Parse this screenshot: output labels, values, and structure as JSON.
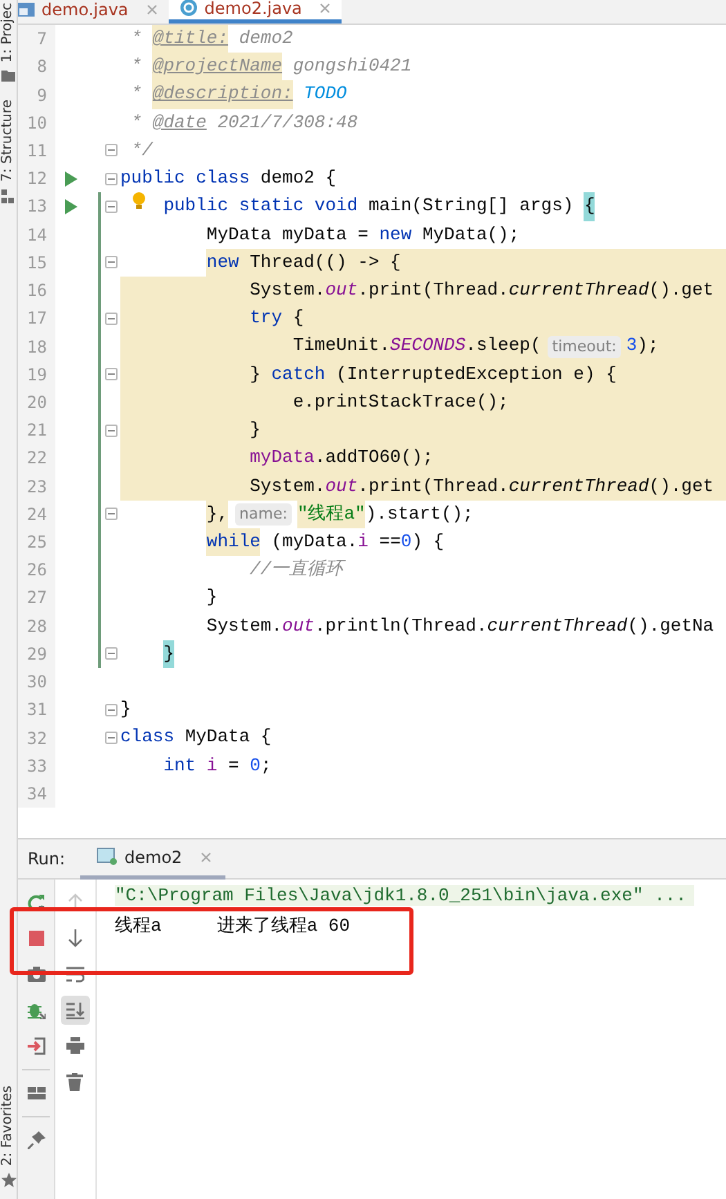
{
  "side_strip": {
    "top": [
      {
        "label": "1: Projec",
        "kind": "project"
      },
      {
        "label": "7: Structure",
        "kind": "structure"
      }
    ],
    "bottom": [
      {
        "label": "2: Favorites",
        "kind": "favorites"
      }
    ]
  },
  "editor": {
    "tabs": [
      {
        "label": "demo.java",
        "selected": false
      },
      {
        "label": "demo2.java",
        "selected": true
      }
    ],
    "lines": [
      {
        "number": "7",
        "run": false,
        "fold": false,
        "changed": false,
        "highlighted": false,
        "tokens": [
          {
            "kind": "comment",
            "text": " * "
          },
          {
            "kind": "doctag",
            "text": "@title:",
            "marked": true
          },
          {
            "kind": "comment",
            "text": " demo2"
          }
        ]
      },
      {
        "number": "8",
        "run": false,
        "fold": false,
        "changed": false,
        "highlighted": false,
        "tokens": [
          {
            "kind": "comment",
            "text": " * "
          },
          {
            "kind": "doctag",
            "text": "@projectName",
            "marked": true
          },
          {
            "kind": "comment",
            "text": " gongshi0421"
          }
        ]
      },
      {
        "number": "9",
        "run": false,
        "fold": false,
        "changed": false,
        "highlighted": false,
        "tokens": [
          {
            "kind": "comment",
            "text": " * "
          },
          {
            "kind": "doctag",
            "text": "@description:",
            "marked": true
          },
          {
            "kind": "todo",
            "text": " TODO"
          }
        ]
      },
      {
        "number": "10",
        "run": false,
        "fold": false,
        "changed": false,
        "highlighted": false,
        "tokens": [
          {
            "kind": "comment",
            "text": " * "
          },
          {
            "kind": "doctag",
            "text": "@date"
          },
          {
            "kind": "comment",
            "text": " 2021/7/308:48"
          }
        ]
      },
      {
        "number": "11",
        "run": false,
        "fold": true,
        "changed": false,
        "highlighted": false,
        "tokens": [
          {
            "kind": "comment",
            "text": " */"
          }
        ]
      },
      {
        "number": "12",
        "run": true,
        "fold": true,
        "changed": false,
        "highlighted": false,
        "tokens": [
          {
            "kind": "keyword",
            "text": "public class"
          },
          {
            "kind": "plain",
            "text": " demo2 {"
          }
        ]
      },
      {
        "number": "13",
        "run": true,
        "fold": true,
        "changed": true,
        "highlighted": false,
        "tokens": [
          {
            "kind": "bulb"
          },
          {
            "kind": "keyword",
            "text": "    public static void"
          },
          {
            "kind": "plain",
            "text": " main(String[] args) "
          },
          {
            "kind": "brace",
            "text": "{"
          }
        ]
      },
      {
        "number": "14",
        "run": false,
        "fold": false,
        "changed": true,
        "highlighted": false,
        "tokens": [
          {
            "kind": "plain",
            "text": "        MyData myData = "
          },
          {
            "kind": "keyword",
            "text": "new"
          },
          {
            "kind": "plain",
            "text": " MyData();"
          }
        ]
      },
      {
        "number": "15",
        "run": false,
        "fold": true,
        "changed": true,
        "highlighted": true,
        "tokens": [
          {
            "kind": "keyword",
            "text": "        new"
          },
          {
            "kind": "plain",
            "text": " Thread(() -> {"
          }
        ]
      },
      {
        "number": "16",
        "run": false,
        "fold": false,
        "changed": true,
        "highlighted": true,
        "tokens": [
          {
            "kind": "plain",
            "text": "            System."
          },
          {
            "kind": "field",
            "text": "out"
          },
          {
            "kind": "plain",
            "text": ".print(Thread."
          },
          {
            "kind": "static_call",
            "text": "currentThread"
          },
          {
            "kind": "plain",
            "text": "().get"
          }
        ]
      },
      {
        "number": "17",
        "run": false,
        "fold": true,
        "changed": true,
        "highlighted": true,
        "tokens": [
          {
            "kind": "keyword",
            "text": "            try"
          },
          {
            "kind": "plain",
            "text": " {"
          }
        ]
      },
      {
        "number": "18",
        "run": false,
        "fold": false,
        "changed": true,
        "highlighted": true,
        "tokens": [
          {
            "kind": "plain",
            "text": "                TimeUnit."
          },
          {
            "kind": "field",
            "text": "SECONDS"
          },
          {
            "kind": "plain",
            "text": ".sleep("
          },
          {
            "kind": "hint",
            "text": "timeout:"
          },
          {
            "kind": "number",
            "text": "3"
          },
          {
            "kind": "plain",
            "text": ");"
          }
        ]
      },
      {
        "number": "19",
        "run": false,
        "fold": true,
        "changed": true,
        "highlighted": true,
        "tokens": [
          {
            "kind": "plain",
            "text": "            } "
          },
          {
            "kind": "keyword",
            "text": "catch"
          },
          {
            "kind": "plain",
            "text": " (InterruptedException e) {"
          }
        ]
      },
      {
        "number": "20",
        "run": false,
        "fold": false,
        "changed": true,
        "highlighted": true,
        "tokens": [
          {
            "kind": "plain",
            "text": "                e.printStackTrace();"
          }
        ]
      },
      {
        "number": "21",
        "run": false,
        "fold": true,
        "changed": true,
        "highlighted": true,
        "tokens": [
          {
            "kind": "plain",
            "text": "            }"
          }
        ]
      },
      {
        "number": "22",
        "run": false,
        "fold": false,
        "changed": true,
        "highlighted": true,
        "tokens": [
          {
            "kind": "variable",
            "text": "            myData"
          },
          {
            "kind": "plain",
            "text": ".addTO60();"
          }
        ]
      },
      {
        "number": "23",
        "run": false,
        "fold": false,
        "changed": true,
        "highlighted": true,
        "tokens": [
          {
            "kind": "plain",
            "text": "            System."
          },
          {
            "kind": "field",
            "text": "out"
          },
          {
            "kind": "plain",
            "text": ".print(Thread."
          },
          {
            "kind": "static_call",
            "text": "currentThread"
          },
          {
            "kind": "plain",
            "text": "().get"
          }
        ]
      },
      {
        "number": "24",
        "run": false,
        "fold": true,
        "changed": true,
        "highlighted": false,
        "tokens": [
          {
            "kind": "plain",
            "text": "        },",
            "marked": true
          },
          {
            "kind": "hint",
            "text": "name:"
          },
          {
            "kind": "string",
            "text": "\"线程a\"",
            "marked": true
          },
          {
            "kind": "plain",
            "text": ").start();"
          }
        ]
      },
      {
        "number": "25",
        "run": false,
        "fold": false,
        "changed": true,
        "highlighted": false,
        "tokens": [
          {
            "kind": "keyword",
            "text": "        while",
            "marked": true
          },
          {
            "kind": "plain",
            "text": " (myData."
          },
          {
            "kind": "variable",
            "text": "i"
          },
          {
            "kind": "plain",
            "text": " =="
          },
          {
            "kind": "number",
            "text": "0"
          },
          {
            "kind": "plain",
            "text": ") {"
          }
        ]
      },
      {
        "number": "26",
        "run": false,
        "fold": false,
        "changed": true,
        "highlighted": false,
        "tokens": [
          {
            "kind": "comment",
            "text": "            //一直循环"
          }
        ]
      },
      {
        "number": "27",
        "run": false,
        "fold": false,
        "changed": true,
        "highlighted": false,
        "tokens": [
          {
            "kind": "plain",
            "text": "        }"
          }
        ]
      },
      {
        "number": "28",
        "run": false,
        "fold": false,
        "changed": true,
        "highlighted": false,
        "tokens": [
          {
            "kind": "plain",
            "text": "        System."
          },
          {
            "kind": "field",
            "text": "out"
          },
          {
            "kind": "plain",
            "text": ".println(Thread."
          },
          {
            "kind": "static_call",
            "text": "currentThread"
          },
          {
            "kind": "plain",
            "text": "().getNa"
          }
        ]
      },
      {
        "number": "29",
        "run": false,
        "fold": true,
        "changed": true,
        "highlighted": false,
        "tokens": [
          {
            "kind": "brace",
            "text": "    }"
          }
        ]
      },
      {
        "number": "30",
        "run": false,
        "fold": false,
        "changed": false,
        "highlighted": false
      },
      {
        "number": "31",
        "run": false,
        "fold": true,
        "changed": false,
        "highlighted": false,
        "tokens": [
          {
            "kind": "plain",
            "text": "}"
          }
        ]
      },
      {
        "number": "32",
        "run": false,
        "fold": true,
        "changed": false,
        "highlighted": false,
        "tokens": [
          {
            "kind": "keyword",
            "text": "class"
          },
          {
            "kind": "plain",
            "text": " MyData {"
          }
        ]
      },
      {
        "number": "33",
        "run": false,
        "fold": false,
        "changed": false,
        "highlighted": false,
        "tokens": [
          {
            "kind": "keyword",
            "text": "    int"
          },
          {
            "kind": "variable",
            "text": " i"
          },
          {
            "kind": "plain",
            "text": " = "
          },
          {
            "kind": "number",
            "text": "0"
          },
          {
            "kind": "plain",
            "text": ";"
          }
        ]
      },
      {
        "number": "34",
        "run": false,
        "fold": false,
        "changed": false,
        "highlighted": false
      }
    ]
  },
  "run": {
    "title": "Run:",
    "tab": {
      "label": "demo2"
    },
    "toolbar_main": [
      {
        "kind": "rerun"
      },
      {
        "kind": "stop"
      },
      {
        "kind": "camera"
      },
      {
        "kind": "debug"
      },
      {
        "kind": "exit"
      },
      {
        "kind": "layout"
      },
      {
        "kind": "pin"
      }
    ],
    "toolbar_side": [
      {
        "kind": "up",
        "disabled": true,
        "selected": false
      },
      {
        "kind": "down",
        "disabled": false,
        "selected": false
      },
      {
        "kind": "wrap",
        "disabled": false,
        "selected": false
      },
      {
        "kind": "scroll_end",
        "disabled": false,
        "selected": true
      },
      {
        "kind": "print",
        "disabled": false,
        "selected": false
      },
      {
        "kind": "trash",
        "disabled": false,
        "selected": false
      }
    ],
    "console": [
      {
        "kind": "command",
        "segments": [
          "\"C:\\Program Files\\Java\\jdk1.8.0_251\\bin\\java.exe\" ..."
        ]
      },
      {
        "kind": "output",
        "segments": [
          "线程a",
          "进来了线程a 60"
        ]
      }
    ]
  }
}
